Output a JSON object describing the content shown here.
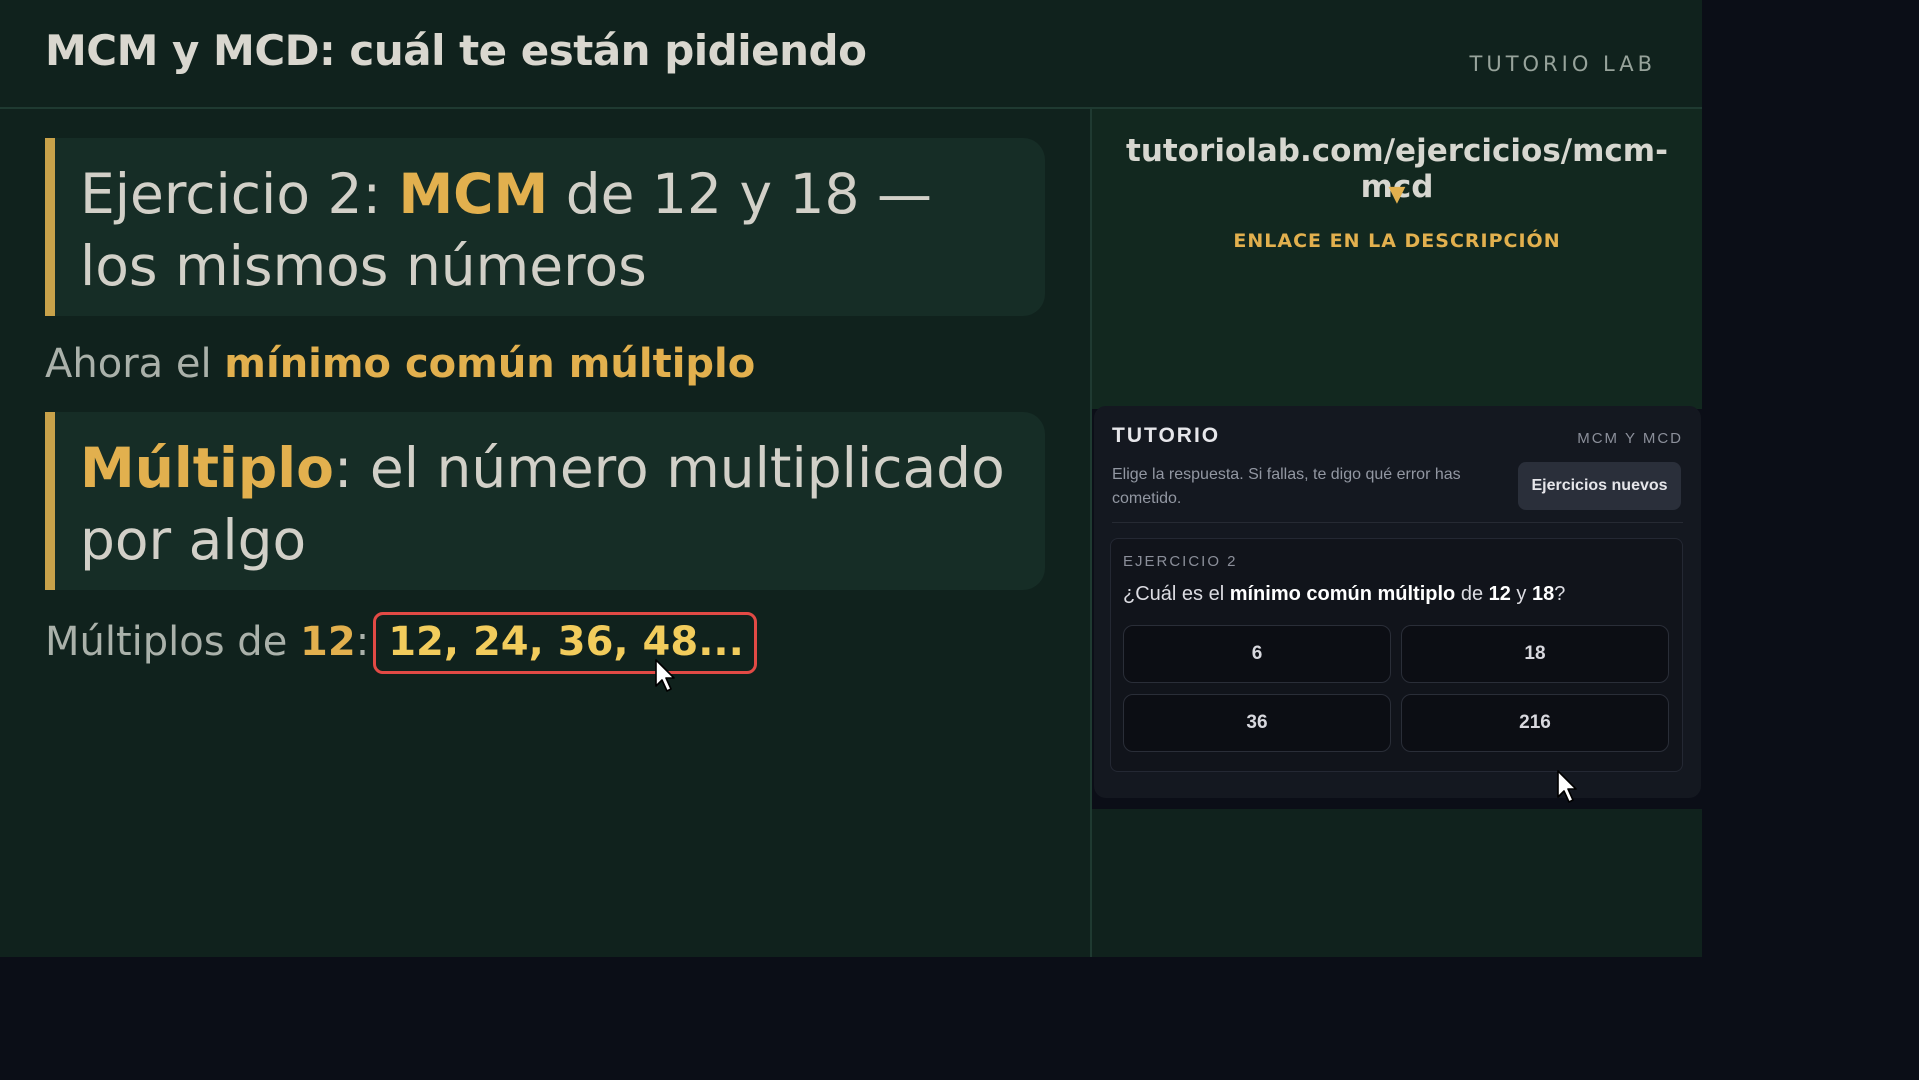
{
  "header": {
    "title": "MCM y MCD: cuál te están pidiendo",
    "brand": "TUTORIO LAB"
  },
  "lesson": {
    "card1": {
      "prefix": "Ejercicio 2: ",
      "highlight": "MCM",
      "suffix": " de 12 y 18 — los mismos números"
    },
    "line1": {
      "prefix": "Ahora el ",
      "highlight": "mínimo común múltiplo"
    },
    "card2": {
      "highlight": "Múltiplo",
      "suffix": ": el número multiplicado por algo"
    },
    "line2": {
      "prefix": "Múltiplos de ",
      "number": "12",
      "colon": ":",
      "boxed": "12, 24, 36, 48..."
    }
  },
  "link_panel": {
    "url": "tutoriolab.com/ejercicios/mcm-mcd",
    "arrow": "▼",
    "note": "ENLACE EN LA DESCRIPCIÓN"
  },
  "widget": {
    "title": "TUTORIO",
    "topic": "MCM Y MCD",
    "description": "Elige la respuesta. Si fallas, te digo qué error has cometido.",
    "new_button": "Ejercicios nuevos",
    "exercise": {
      "label": "EJERCICIO 2",
      "question_parts": {
        "p1": "¿Cuál es el ",
        "b1": "mínimo común múltiplo",
        "p2": " de ",
        "b2": "12",
        "p3": " y ",
        "b3": "18",
        "p4": "?"
      },
      "options": [
        "6",
        "18",
        "36",
        "216"
      ]
    }
  },
  "colors": {
    "board_bg": "#10221d",
    "accent_gold": "#e2b04e",
    "highlight_red": "#e24a45",
    "widget_bg": "#141820"
  },
  "icons": [
    "mouse-cursor-icon"
  ]
}
